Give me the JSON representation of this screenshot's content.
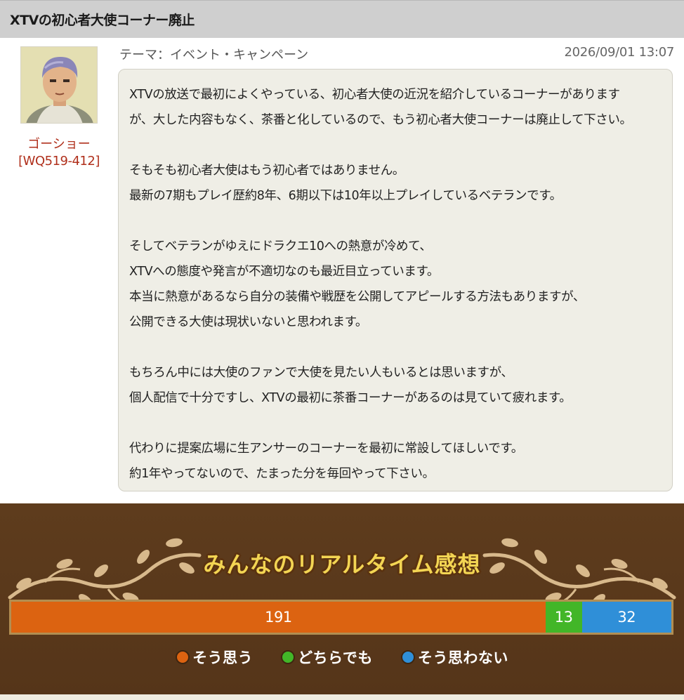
{
  "post": {
    "title": "XTVの初心者大使コーナー廃止",
    "theme": "テーマ：イベント・キャンペーン",
    "datetime": "2026/09/01 13:07",
    "author": {
      "name": "ゴーショー",
      "id": "[WQ519-412]"
    },
    "body": [
      "XTVの放送で最初によくやっている、初心者大使の近況を紹介しているコーナーがあります",
      "が、大した内容もなく、茶番と化しているので、もう初心者大使コーナーは廃止して下さい。",
      "",
      "そもそも初心者大使はもう初心者ではありません。",
      "最新の7期もプレイ歴約8年、6期以下は10年以上プレイしているベテランです。",
      "",
      "そしてベテランがゆえにドラクエ10への熱意が冷めて、",
      "XTVへの態度や発言が不適切なのも最近目立っています。",
      "本当に熱意があるなら自分の装備や戦歴を公開してアピールする方法もありますが、",
      "公開できる大使は現状いないと思われます。",
      "",
      "もちろん中には大使のファンで大使を見たい人もいるとは思いますが、",
      "個人配信で十分ですし、XTVの最初に茶番コーナーがあるのは見ていて疲れます。",
      "",
      "代わりに提案広場に生アンサーのコーナーを最初に常設してほしいです。",
      "約1年やってないので、たまった分を毎回やって下さい。"
    ]
  },
  "realtime": {
    "title": "みんなのリアルタイム感想",
    "votes": [
      {
        "key": "yes",
        "label": "そう思う",
        "count": "191",
        "value": 191,
        "color": "#dc6311"
      },
      {
        "key": "neutral",
        "label": "どちらでも",
        "count": "13",
        "value": 13,
        "color": "#42b628"
      },
      {
        "key": "no",
        "label": "そう思わない",
        "count": "32",
        "value": 32,
        "color": "#2f8fd8"
      }
    ]
  }
}
